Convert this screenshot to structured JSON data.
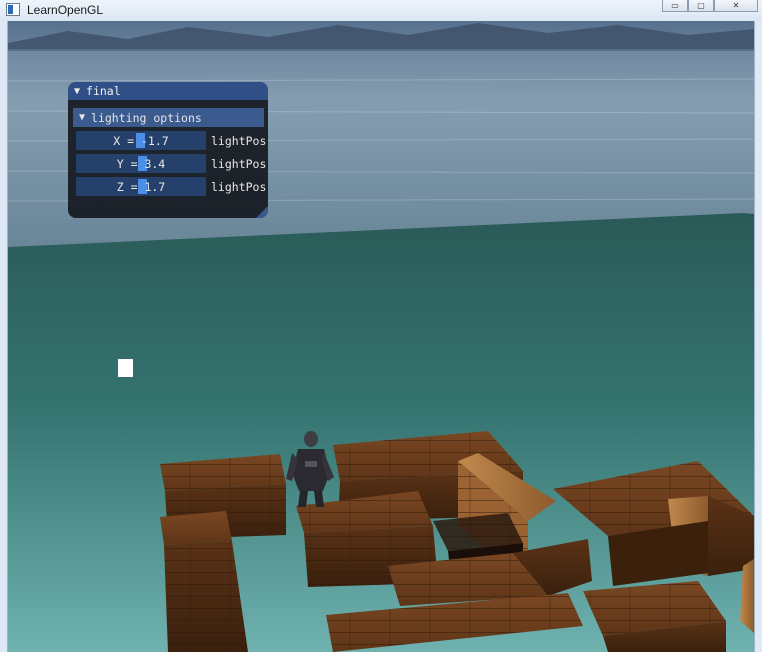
{
  "window": {
    "title": "LearnOpenGL",
    "minimize_glyph": "▭",
    "maximize_glyph": "▢",
    "close_glyph": "✕"
  },
  "gui": {
    "window_title": "final",
    "collapse_glyph": "▼",
    "section": {
      "label": "lighting options",
      "glyph": "▼"
    },
    "sliders": [
      {
        "text": "X = -1.7",
        "label": "lightPos",
        "value": -1.7
      },
      {
        "text": "Y = 3.4",
        "label": "lightPos",
        "value": 3.4
      },
      {
        "text": "Z = 1.7",
        "label": "lightPos",
        "value": 1.7
      }
    ]
  },
  "colors": {
    "gui_title": "#2f4f86",
    "gui_header": "#3b5a8e",
    "slider_bg": "#25416b",
    "slider_grab": "#4d8fe8",
    "water": "#2e6a64",
    "crate_wood": "#6a3c1e"
  }
}
